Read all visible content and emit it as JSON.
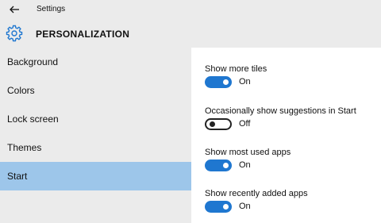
{
  "window": {
    "title": "Settings"
  },
  "header": {
    "title": "PERSONALIZATION"
  },
  "sidebar": {
    "items": [
      {
        "label": "Background"
      },
      {
        "label": "Colors"
      },
      {
        "label": "Lock screen"
      },
      {
        "label": "Themes"
      },
      {
        "label": "Start",
        "selected": true
      }
    ]
  },
  "settings": [
    {
      "label": "Show more tiles",
      "state": "On",
      "on": true
    },
    {
      "label": "Occasionally show suggestions in Start",
      "state": "Off",
      "on": false
    },
    {
      "label": "Show most used apps",
      "state": "On",
      "on": true
    },
    {
      "label": "Show recently added apps",
      "state": "On",
      "on": true
    }
  ],
  "colors": {
    "accent": "#1f77d0",
    "selected_nav": "#9dc6ea",
    "chrome": "#ebebeb"
  },
  "icons": {
    "back": "arrow-left-icon",
    "header": "gear-icon"
  }
}
